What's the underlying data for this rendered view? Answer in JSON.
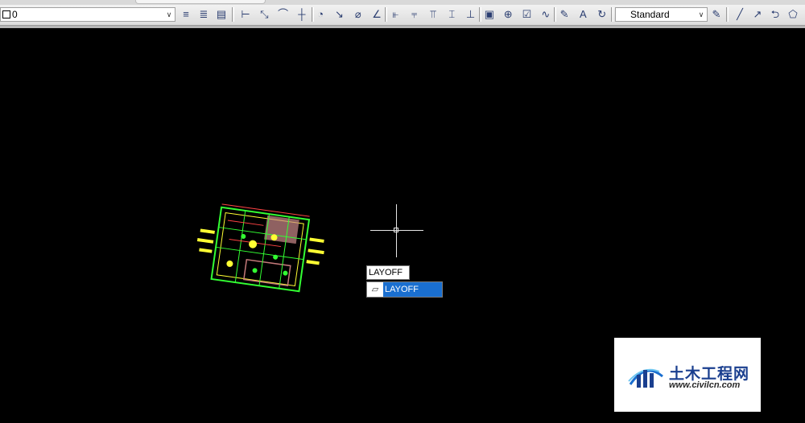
{
  "toolbar": {
    "layer_value": "0",
    "text_style_value": "Standard",
    "dropdown_glyph": "∨",
    "icons_left": [
      {
        "name": "layer-properties-icon",
        "glyph": "≡"
      },
      {
        "name": "layer-states-icon",
        "glyph": "≣"
      },
      {
        "name": "make-object-layer-current-icon",
        "glyph": "▤"
      }
    ],
    "icons_dim": [
      {
        "name": "linear-dimension-icon",
        "glyph": "⊢"
      },
      {
        "name": "aligned-dimension-icon",
        "glyph": "⤡"
      },
      {
        "name": "arc-length-icon",
        "glyph": "⌒"
      },
      {
        "name": "ordinate-dimension-icon",
        "glyph": "┼"
      },
      {
        "name": "radius-dimension-icon",
        "glyph": "◔"
      },
      {
        "name": "jogged-dimension-icon",
        "glyph": "↘"
      },
      {
        "name": "diameter-dimension-icon",
        "glyph": "⌀"
      },
      {
        "name": "angular-dimension-icon",
        "glyph": "∠"
      },
      {
        "name": "quick-dimension-icon",
        "glyph": "⫦"
      },
      {
        "name": "baseline-dimension-icon",
        "glyph": "⫧"
      },
      {
        "name": "continue-dimension-icon",
        "glyph": "⫪"
      },
      {
        "name": "dimension-space-icon",
        "glyph": "⌶"
      },
      {
        "name": "dimension-break-icon",
        "glyph": "⊥"
      },
      {
        "name": "tolerance-icon",
        "glyph": "▣"
      },
      {
        "name": "center-mark-icon",
        "glyph": "⊕"
      },
      {
        "name": "inspection-icon",
        "glyph": "☑"
      },
      {
        "name": "jogged-linear-icon",
        "glyph": "∿"
      },
      {
        "name": "dimension-edit-icon",
        "glyph": "✎"
      },
      {
        "name": "dimension-text-edit-icon",
        "glyph": "A"
      },
      {
        "name": "dimension-update-icon",
        "glyph": "↻"
      }
    ],
    "icons_right": [
      {
        "name": "line-icon",
        "glyph": "╱"
      },
      {
        "name": "ray-icon",
        "glyph": "↗"
      },
      {
        "name": "polyline-icon",
        "glyph": "⮌"
      },
      {
        "name": "polygon-icon",
        "glyph": "⬠"
      }
    ],
    "text_style_icon": "✎"
  },
  "autocomplete": {
    "typed": "LAYOFF",
    "suggestion": "LAYOFF",
    "suggestion_icon": "▱"
  },
  "watermark": {
    "name_cn": "土木工程网",
    "url": "www.civilcn.com"
  }
}
